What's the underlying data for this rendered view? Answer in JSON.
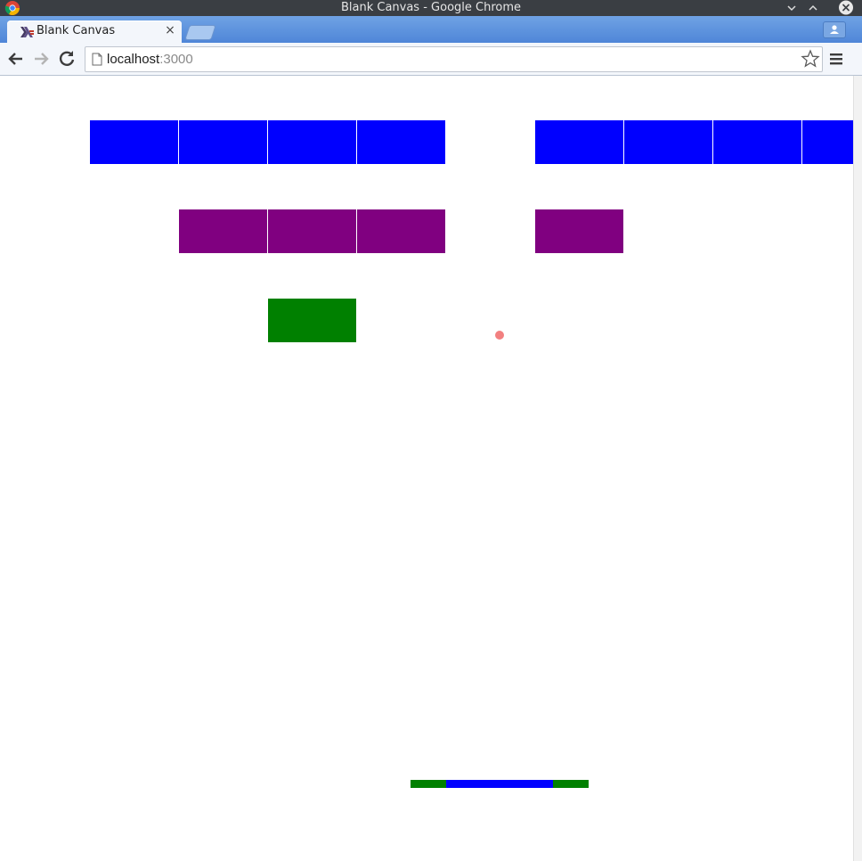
{
  "window": {
    "title": "Blank Canvas - Google Chrome"
  },
  "tab": {
    "title": "Blank Canvas",
    "close_glyph": "×"
  },
  "toolbar": {
    "url_host": "localhost",
    "url_port": ":3000",
    "icons": [
      "back-arrow-icon",
      "forward-arrow-icon",
      "reload-icon",
      "page-icon",
      "star-icon",
      "menu-icon"
    ]
  },
  "game": {
    "colors": {
      "blue": "#0000ff",
      "purple": "#800080",
      "green": "#008000",
      "ball": "#f28080",
      "background": "#ffffff"
    },
    "grid": {
      "columns": 10,
      "rows": 4
    },
    "bricks": [
      {
        "row": 0,
        "col": 1,
        "color": "blue"
      },
      {
        "row": 0,
        "col": 2,
        "color": "blue"
      },
      {
        "row": 0,
        "col": 3,
        "color": "blue"
      },
      {
        "row": 0,
        "col": 4,
        "color": "blue"
      },
      {
        "row": 0,
        "col": 6,
        "color": "blue"
      },
      {
        "row": 0,
        "col": 7,
        "color": "blue"
      },
      {
        "row": 0,
        "col": 8,
        "color": "blue"
      },
      {
        "row": 0,
        "col": 9,
        "color": "blue"
      },
      {
        "row": 1,
        "col": 2,
        "color": "purple"
      },
      {
        "row": 1,
        "col": 3,
        "color": "purple"
      },
      {
        "row": 1,
        "col": 4,
        "color": "purple"
      },
      {
        "row": 1,
        "col": 6,
        "color": "purple"
      },
      {
        "row": 2,
        "col": 3,
        "color": "green"
      }
    ],
    "paddle": {
      "segments": [
        "green",
        "blue",
        "blue",
        "blue",
        "green"
      ]
    },
    "ball": {
      "color": "ball"
    }
  }
}
